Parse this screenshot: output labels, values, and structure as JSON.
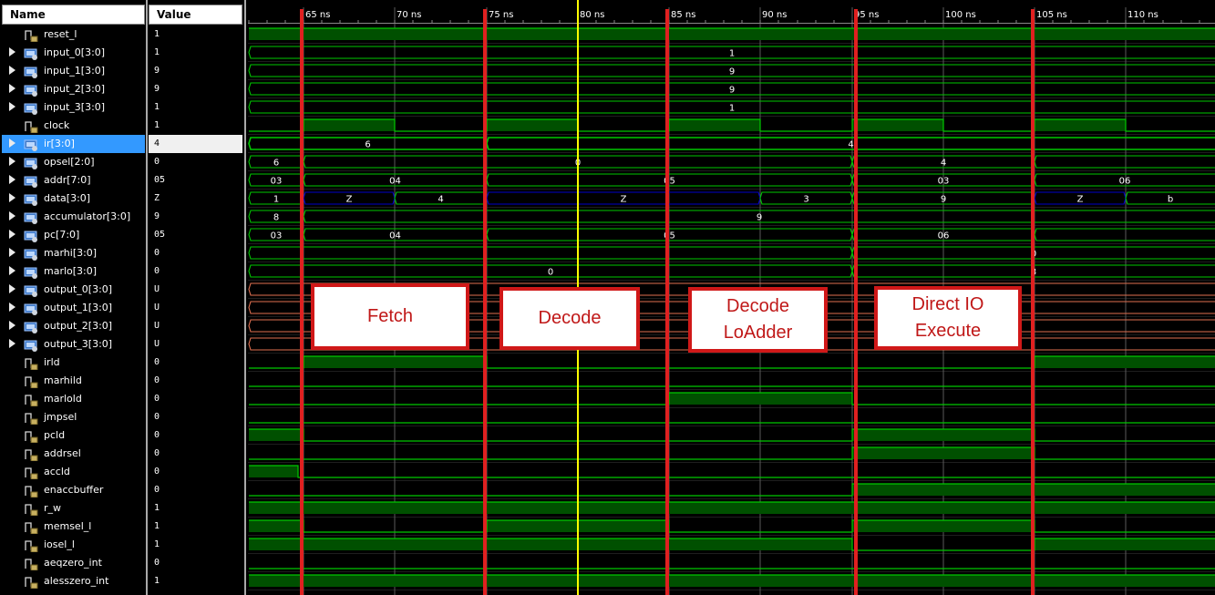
{
  "headers": {
    "name": "Name",
    "value": "Value"
  },
  "selected_signal": "ir[3:0]",
  "colors": {
    "wave": "#00c800",
    "wave_fill": "#005000",
    "bus_z": "#0000c8",
    "bus_u": "#e07050",
    "cursor": "#ffff00",
    "phase_marker": "#e02020",
    "grid": "#707070"
  },
  "timeline": {
    "ticks": [
      "65 ns",
      "70 ns",
      "75 ns",
      "80 ns",
      "85 ns",
      "90 ns",
      "95 ns",
      "100 ns",
      "105 ns",
      "110 ns"
    ],
    "cursor_time": 80
  },
  "signals": [
    {
      "name": "reset_l",
      "value": "1",
      "bus": false
    },
    {
      "name": "input_0[3:0]",
      "value": "1",
      "bus": true
    },
    {
      "name": "input_1[3:0]",
      "value": "9",
      "bus": true
    },
    {
      "name": "input_2[3:0]",
      "value": "9",
      "bus": true
    },
    {
      "name": "input_3[3:0]",
      "value": "1",
      "bus": true
    },
    {
      "name": "clock",
      "value": "1",
      "bus": false
    },
    {
      "name": "ir[3:0]",
      "value": "4",
      "bus": true
    },
    {
      "name": "opsel[2:0]",
      "value": "0",
      "bus": true
    },
    {
      "name": "addr[7:0]",
      "value": "05",
      "bus": true
    },
    {
      "name": "data[3:0]",
      "value": "Z",
      "bus": true
    },
    {
      "name": "accumulator[3:0]",
      "value": "9",
      "bus": true
    },
    {
      "name": "pc[7:0]",
      "value": "05",
      "bus": true
    },
    {
      "name": "marhi[3:0]",
      "value": "0",
      "bus": true
    },
    {
      "name": "marlo[3:0]",
      "value": "0",
      "bus": true
    },
    {
      "name": "output_0[3:0]",
      "value": "U",
      "bus": true
    },
    {
      "name": "output_1[3:0]",
      "value": "U",
      "bus": true
    },
    {
      "name": "output_2[3:0]",
      "value": "U",
      "bus": true
    },
    {
      "name": "output_3[3:0]",
      "value": "U",
      "bus": true
    },
    {
      "name": "irld",
      "value": "0",
      "bus": false
    },
    {
      "name": "marhild",
      "value": "0",
      "bus": false
    },
    {
      "name": "marlold",
      "value": "0",
      "bus": false
    },
    {
      "name": "jmpsel",
      "value": "0",
      "bus": false
    },
    {
      "name": "pcld",
      "value": "0",
      "bus": false
    },
    {
      "name": "addrsel",
      "value": "0",
      "bus": false
    },
    {
      "name": "accld",
      "value": "0",
      "bus": false
    },
    {
      "name": "enaccbuffer",
      "value": "0",
      "bus": false
    },
    {
      "name": "r_w",
      "value": "1",
      "bus": false
    },
    {
      "name": "memsel_l",
      "value": "1",
      "bus": false
    },
    {
      "name": "iosel_l",
      "value": "1",
      "bus": false
    },
    {
      "name": "aeqzero_int",
      "value": "0",
      "bus": false
    },
    {
      "name": "alesszero_int",
      "value": "1",
      "bus": false
    }
  ],
  "waveforms": {
    "reset_l": {
      "type": "bit",
      "start": 62,
      "edges": [],
      "init": 1
    },
    "clock": {
      "type": "bit",
      "start": 62,
      "edges": [
        65,
        70,
        75,
        80,
        85,
        90,
        95,
        100,
        105,
        110
      ],
      "init": 0
    },
    "irld": {
      "type": "bit",
      "start": 62,
      "edges": [
        65,
        75,
        105
      ],
      "init": 0
    },
    "marhild": {
      "type": "bit",
      "start": 62,
      "edges": [],
      "init": 0
    },
    "marlold": {
      "type": "bit",
      "start": 62,
      "edges": [
        85,
        95
      ],
      "init": 0
    },
    "jmpsel": {
      "type": "bit",
      "start": 62,
      "edges": [],
      "init": 0
    },
    "pcld": {
      "type": "bit",
      "start": 62,
      "edges": [
        65,
        95,
        105
      ],
      "init": 1
    },
    "addrsel": {
      "type": "bit",
      "start": 62,
      "edges": [
        95,
        105
      ],
      "init": 0
    },
    "accld": {
      "type": "bit",
      "start": 62,
      "edges": [
        64.7
      ],
      "init": 1
    },
    "enaccbuffer": {
      "type": "bit",
      "start": 62,
      "edges": [
        95
      ],
      "init": 0
    },
    "r_w": {
      "type": "bit",
      "start": 62,
      "edges": [],
      "init": 1
    },
    "memsel_l": {
      "type": "bit",
      "start": 62,
      "edges": [
        65,
        75,
        85,
        95,
        105
      ],
      "init": 1
    },
    "iosel_l": {
      "type": "bit",
      "start": 62,
      "edges": [
        95,
        105
      ],
      "init": 1
    },
    "aeqzero_int": {
      "type": "bit",
      "start": 62,
      "edges": [],
      "init": 0
    },
    "alesszero_int": {
      "type": "bit",
      "start": 62,
      "edges": [],
      "init": 1
    },
    "input_0[3:0]": {
      "type": "bus",
      "segments": [
        {
          "from": 62,
          "to": 115,
          "label": "1"
        }
      ]
    },
    "input_1[3:0]": {
      "type": "bus",
      "segments": [
        {
          "from": 62,
          "to": 115,
          "label": "9"
        }
      ]
    },
    "input_2[3:0]": {
      "type": "bus",
      "segments": [
        {
          "from": 62,
          "to": 115,
          "label": "9"
        }
      ]
    },
    "input_3[3:0]": {
      "type": "bus",
      "segments": [
        {
          "from": 62,
          "to": 115,
          "label": "1"
        }
      ]
    },
    "ir[3:0]": {
      "type": "bus",
      "selected": true,
      "segments": [
        {
          "from": 62,
          "to": 75,
          "label": "6"
        },
        {
          "from": 75,
          "to": 115,
          "label": "4"
        }
      ]
    },
    "opsel[2:0]": {
      "type": "bus",
      "segments": [
        {
          "from": 62,
          "to": 65,
          "label": "6"
        },
        {
          "from": 65,
          "to": 95,
          "label": "0"
        },
        {
          "from": 95,
          "to": 105,
          "label": "4"
        },
        {
          "from": 105,
          "to": 115,
          "label": ""
        }
      ]
    },
    "addr[7:0]": {
      "type": "bus",
      "segments": [
        {
          "from": 62,
          "to": 65,
          "label": "03"
        },
        {
          "from": 65,
          "to": 75,
          "label": "04"
        },
        {
          "from": 75,
          "to": 95,
          "label": "05"
        },
        {
          "from": 95,
          "to": 105,
          "label": "03"
        },
        {
          "from": 105,
          "to": 115,
          "label": "06"
        }
      ]
    },
    "data[3:0]": {
      "type": "bus",
      "segments": [
        {
          "from": 62,
          "to": 65,
          "label": "1"
        },
        {
          "from": 65,
          "to": 70,
          "label": "Z",
          "z": true
        },
        {
          "from": 70,
          "to": 75,
          "label": "4"
        },
        {
          "from": 75,
          "to": 90,
          "label": "Z",
          "z": true
        },
        {
          "from": 90,
          "to": 95,
          "label": "3"
        },
        {
          "from": 95,
          "to": 105,
          "label": "9"
        },
        {
          "from": 105,
          "to": 110,
          "label": "Z",
          "z": true
        },
        {
          "from": 110,
          "to": 115,
          "label": "b"
        }
      ]
    },
    "accumulator[3:0]": {
      "type": "bus",
      "segments": [
        {
          "from": 62,
          "to": 65,
          "label": "8"
        },
        {
          "from": 65,
          "to": 115,
          "label": "9"
        }
      ]
    },
    "pc[7:0]": {
      "type": "bus",
      "segments": [
        {
          "from": 62,
          "to": 65,
          "label": "03"
        },
        {
          "from": 65,
          "to": 75,
          "label": "04"
        },
        {
          "from": 75,
          "to": 95,
          "label": "05"
        },
        {
          "from": 95,
          "to": 105,
          "label": "06"
        },
        {
          "from": 105,
          "to": 115,
          "label": ""
        }
      ]
    },
    "marhi[3:0]": {
      "type": "bus",
      "segments": [
        {
          "from": 62,
          "to": 95,
          "label": ""
        },
        {
          "from": 95,
          "to": 115,
          "label": "0"
        }
      ]
    },
    "marlo[3:0]": {
      "type": "bus",
      "segments": [
        {
          "from": 62,
          "to": 95,
          "label": "0"
        },
        {
          "from": 95,
          "to": 115,
          "label": "3"
        }
      ]
    },
    "output_0[3:0]": {
      "type": "bus",
      "undefined": true,
      "segments": [
        {
          "from": 62,
          "to": 115,
          "label": ""
        }
      ]
    },
    "output_1[3:0]": {
      "type": "bus",
      "undefined": true,
      "segments": [
        {
          "from": 62,
          "to": 115,
          "label": ""
        }
      ]
    },
    "output_2[3:0]": {
      "type": "bus",
      "undefined": true,
      "segments": [
        {
          "from": 62,
          "to": 115,
          "label": ""
        }
      ]
    },
    "output_3[3:0]": {
      "type": "bus",
      "undefined": true,
      "segments": [
        {
          "from": 62,
          "to": 115,
          "label": ""
        }
      ]
    }
  },
  "phase_markers": [
    64.9,
    74.9,
    84.9,
    95.2,
    104.9
  ],
  "phase_labels": [
    {
      "label": "Fetch"
    },
    {
      "label": "Decode"
    },
    {
      "label": "Decode\nLoAdder"
    },
    {
      "label": "Direct IO\nExecute"
    }
  ]
}
